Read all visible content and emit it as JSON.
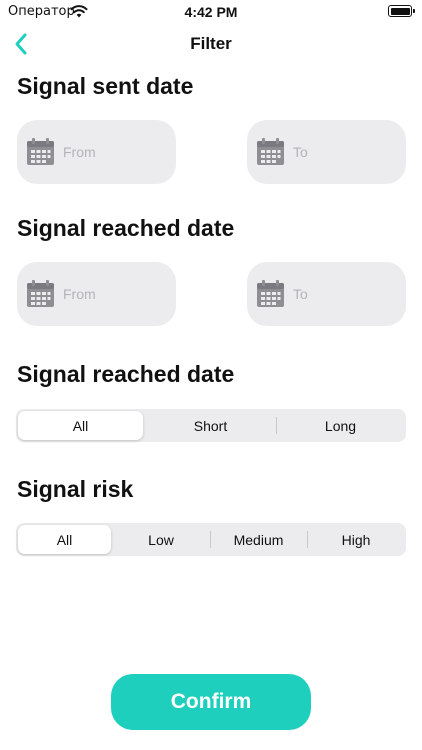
{
  "status_bar": {
    "carrier": "Оператор",
    "time": "4:42 PM"
  },
  "nav": {
    "title": "Filter"
  },
  "sent_date": {
    "title": "Signal sent date",
    "from_placeholder": "From",
    "to_placeholder": "To"
  },
  "reached_date": {
    "title": "Signal reached date",
    "from_placeholder": "From",
    "to_placeholder": "To"
  },
  "duration": {
    "title": "Signal reached date",
    "options": [
      "All",
      "Short",
      "Long"
    ],
    "selected": "All"
  },
  "risk": {
    "title": "Signal risk",
    "options": [
      "All",
      "Low",
      "Medium",
      "High"
    ],
    "selected": "All"
  },
  "confirm_label": "Confirm",
  "colors": {
    "accent": "#1fcfbe",
    "field_bg": "#ececef",
    "placeholder": "#b3b3b8"
  }
}
